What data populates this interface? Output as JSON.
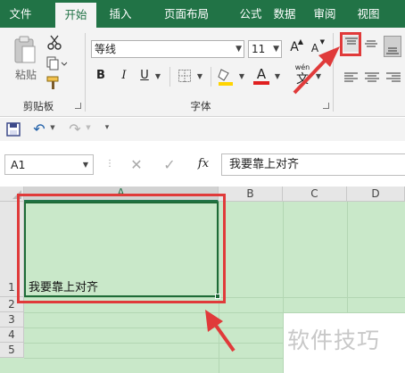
{
  "ribbon_tabs": [
    "文件",
    "开始",
    "插入",
    "页面布局",
    "公式",
    "数据",
    "审阅",
    "视图"
  ],
  "active_tab": "开始",
  "clipboard": {
    "paste_label": "粘贴",
    "group_label": "剪贴板"
  },
  "font": {
    "name": "等线",
    "size": "11",
    "grow_label": "A",
    "shrink_label": "A",
    "bold": "B",
    "italic": "I",
    "underline": "U",
    "font_color_label": "A",
    "phonetic_label": "wén",
    "phonetic_char": "文",
    "group_label": "字体"
  },
  "name_box": "A1",
  "formula_fx": "fx",
  "formula_value": "我要靠上对齐",
  "columns": [
    "A",
    "B",
    "C",
    "D"
  ],
  "rows": [
    "1",
    "2",
    "3",
    "4",
    "5"
  ],
  "cell_a1": "我要靠上对齐",
  "colors": {
    "brand_green": "#217346",
    "selection_green": "#1e6b37",
    "cell_fill": "#c9e8c9",
    "annotation_red": "#e03a3a"
  },
  "watermark": "软件技巧"
}
